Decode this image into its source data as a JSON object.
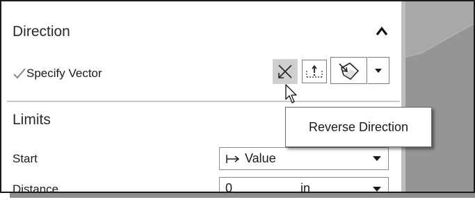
{
  "direction_section": {
    "title": "Direction",
    "collapse_icon": "chevron-up-icon",
    "specify_vector_label": "Specify Vector",
    "status_icon": "check-icon",
    "tools": [
      {
        "name": "reverse-direction-icon",
        "active": true
      },
      {
        "name": "vector-dialog-icon"
      },
      {
        "name": "inferred-vector-icon"
      },
      {
        "name": "dropdown-arrow-icon"
      }
    ]
  },
  "tooltip": {
    "text": "Reverse Direction"
  },
  "limits_section": {
    "title": "Limits",
    "start_label": "Start",
    "start_value": "Value",
    "start_value_icon": "arrow-from-bar-icon",
    "distance_label": "Distance",
    "distance_value": "0",
    "distance_unit": "in"
  },
  "colors": {
    "active_button_bg": "#cfcfcf",
    "check_color": "#8a8a8a",
    "viewport_bg": "#9b9b9b"
  }
}
